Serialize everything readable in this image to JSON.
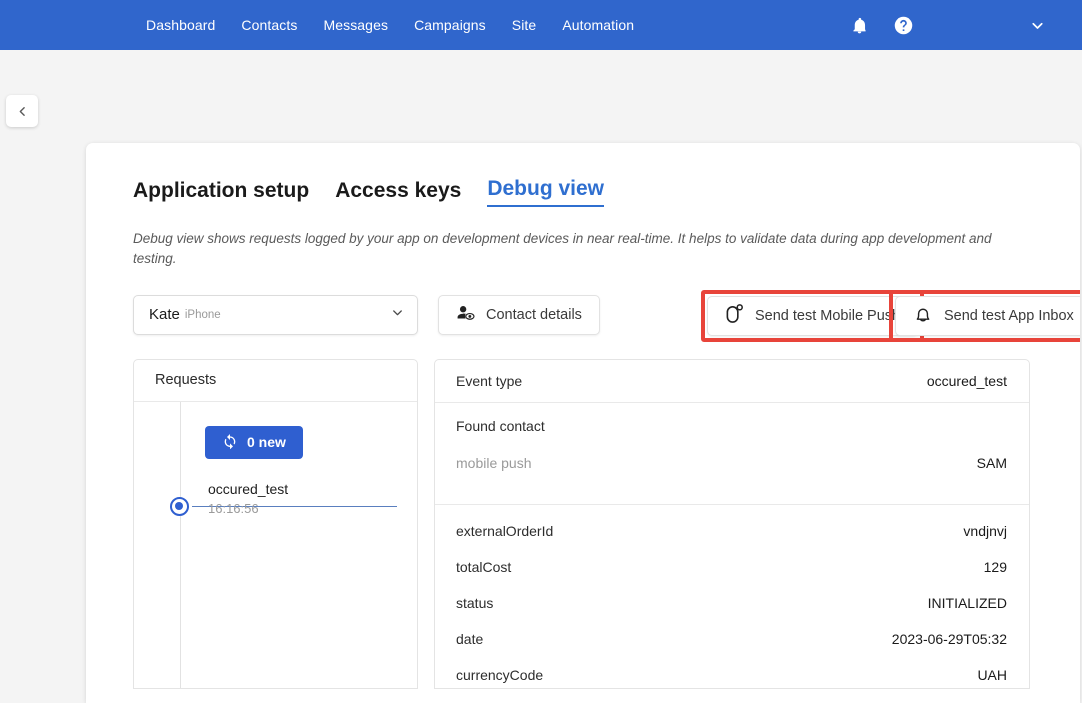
{
  "topbar": {
    "nav": [
      {
        "label": "Dashboard"
      },
      {
        "label": "Contacts"
      },
      {
        "label": "Messages"
      },
      {
        "label": "Campaigns"
      },
      {
        "label": "Site"
      },
      {
        "label": "Automation"
      }
    ],
    "icons": {
      "notifications": "bell-icon",
      "help": "help-circle-icon",
      "account_menu": "chevron-down-icon"
    },
    "brand_color": "#3066cc"
  },
  "sidebar_toggle": {
    "icon": "chevron-left-icon"
  },
  "tabs": [
    {
      "label": "Application setup",
      "active": false
    },
    {
      "label": "Access keys",
      "active": false
    },
    {
      "label": "Debug view",
      "active": true
    }
  ],
  "description": "Debug view shows requests logged by your app on development devices in near real-time. It helps to validate data during app development and testing.",
  "controls": {
    "device_select": {
      "name": "Kate",
      "device": "iPhone",
      "icon": "chevron-down-icon"
    },
    "contact_details_button": {
      "label": "Contact details",
      "icon": "person-eye-icon"
    },
    "send_test_mobile_push_button": {
      "label": "Send test Mobile Push",
      "icon": "mobile-push-icon",
      "highlight_color": "#e8443a"
    },
    "send_test_app_inbox_button": {
      "label": "Send test App Inbox",
      "icon": "bell-outline-icon",
      "highlight_color": "#e8443a"
    }
  },
  "requests_panel": {
    "title": "Requests",
    "refresh_button": {
      "label": "0 new",
      "icon": "refresh-icon"
    },
    "items": [
      {
        "title": "occured_test",
        "time": "16:16:56",
        "selected": true
      }
    ]
  },
  "detail_panel": {
    "event_type": {
      "key": "Event type",
      "value": "occured_test"
    },
    "found_contact": {
      "title": "Found contact",
      "rows": [
        {
          "key": "mobile push",
          "value": "SAM"
        }
      ]
    },
    "attributes": [
      {
        "key": "externalOrderId",
        "value": "vndjnvj"
      },
      {
        "key": "totalCost",
        "value": "129"
      },
      {
        "key": "status",
        "value": "INITIALIZED"
      },
      {
        "key": "date",
        "value": "2023-06-29T05:32"
      },
      {
        "key": "currencyCode",
        "value": "UAH"
      }
    ]
  }
}
